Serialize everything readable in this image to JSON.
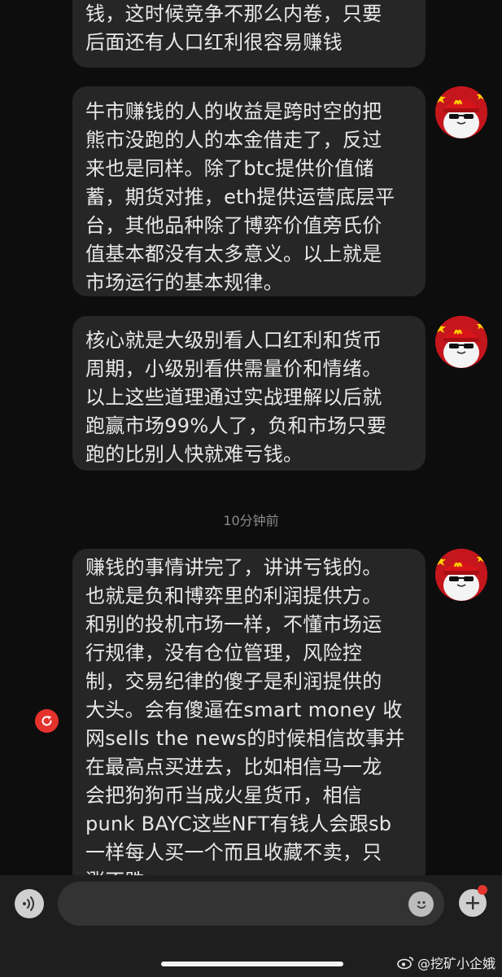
{
  "messages": [
    {
      "text": "钱，这时候竞争不那么内卷，只要\n后面还有人口红利很容易赚钱"
    },
    {
      "text": "牛市赚钱的人的收益是跨时空的把\n熊市没跑的人的本金借走了，反过\n来也是同样。除了btc提供价值储\n蓄，期货对推，eth提供运营底层平\n台，其他品种除了博弈价值旁氏价\n值基本都没有太多意义。以上就是\n市场运行的基本规律。"
    },
    {
      "text": "核心就是大级别看人口红利和货币\n周期，小级别看供需量价和情绪。\n以上这些道理通过实战理解以后就\n跑赢市场99%人了，负和市场只要\n跑的比别人快就难亏钱。"
    },
    {
      "text": "赚钱的事情讲完了，讲讲亏钱的。\n也就是负和博弈里的利润提供方。\n和别的投机市场一样，不懂市场运\n行规律，没有仓位管理，风险控\n制，交易纪律的傻子是利润提供的\n大头。会有傻逼在smart money 收\n网sells the news的时候相信故事并\n在最高点买进去，比如相信马一龙\n会把狗狗币当成火星货币，相信\npunk BAYC这些NFT有钱人会跟sb\n一样每人买一个而且收藏不卖，只\n涨不跌"
    }
  ],
  "timestamp": "10分钟前",
  "composer": {
    "placeholder": ""
  },
  "watermark": "@挖矿小企娥",
  "colors": {
    "background": "#0d0d0d",
    "bubble": "#262626",
    "accent_red": "#e5322d",
    "text": "#e8e8e8"
  },
  "icons": [
    "avatar-mcdonalds-penguin",
    "retry-icon",
    "voice-icon",
    "emoji-icon",
    "plus-icon",
    "weibo-icon"
  ]
}
